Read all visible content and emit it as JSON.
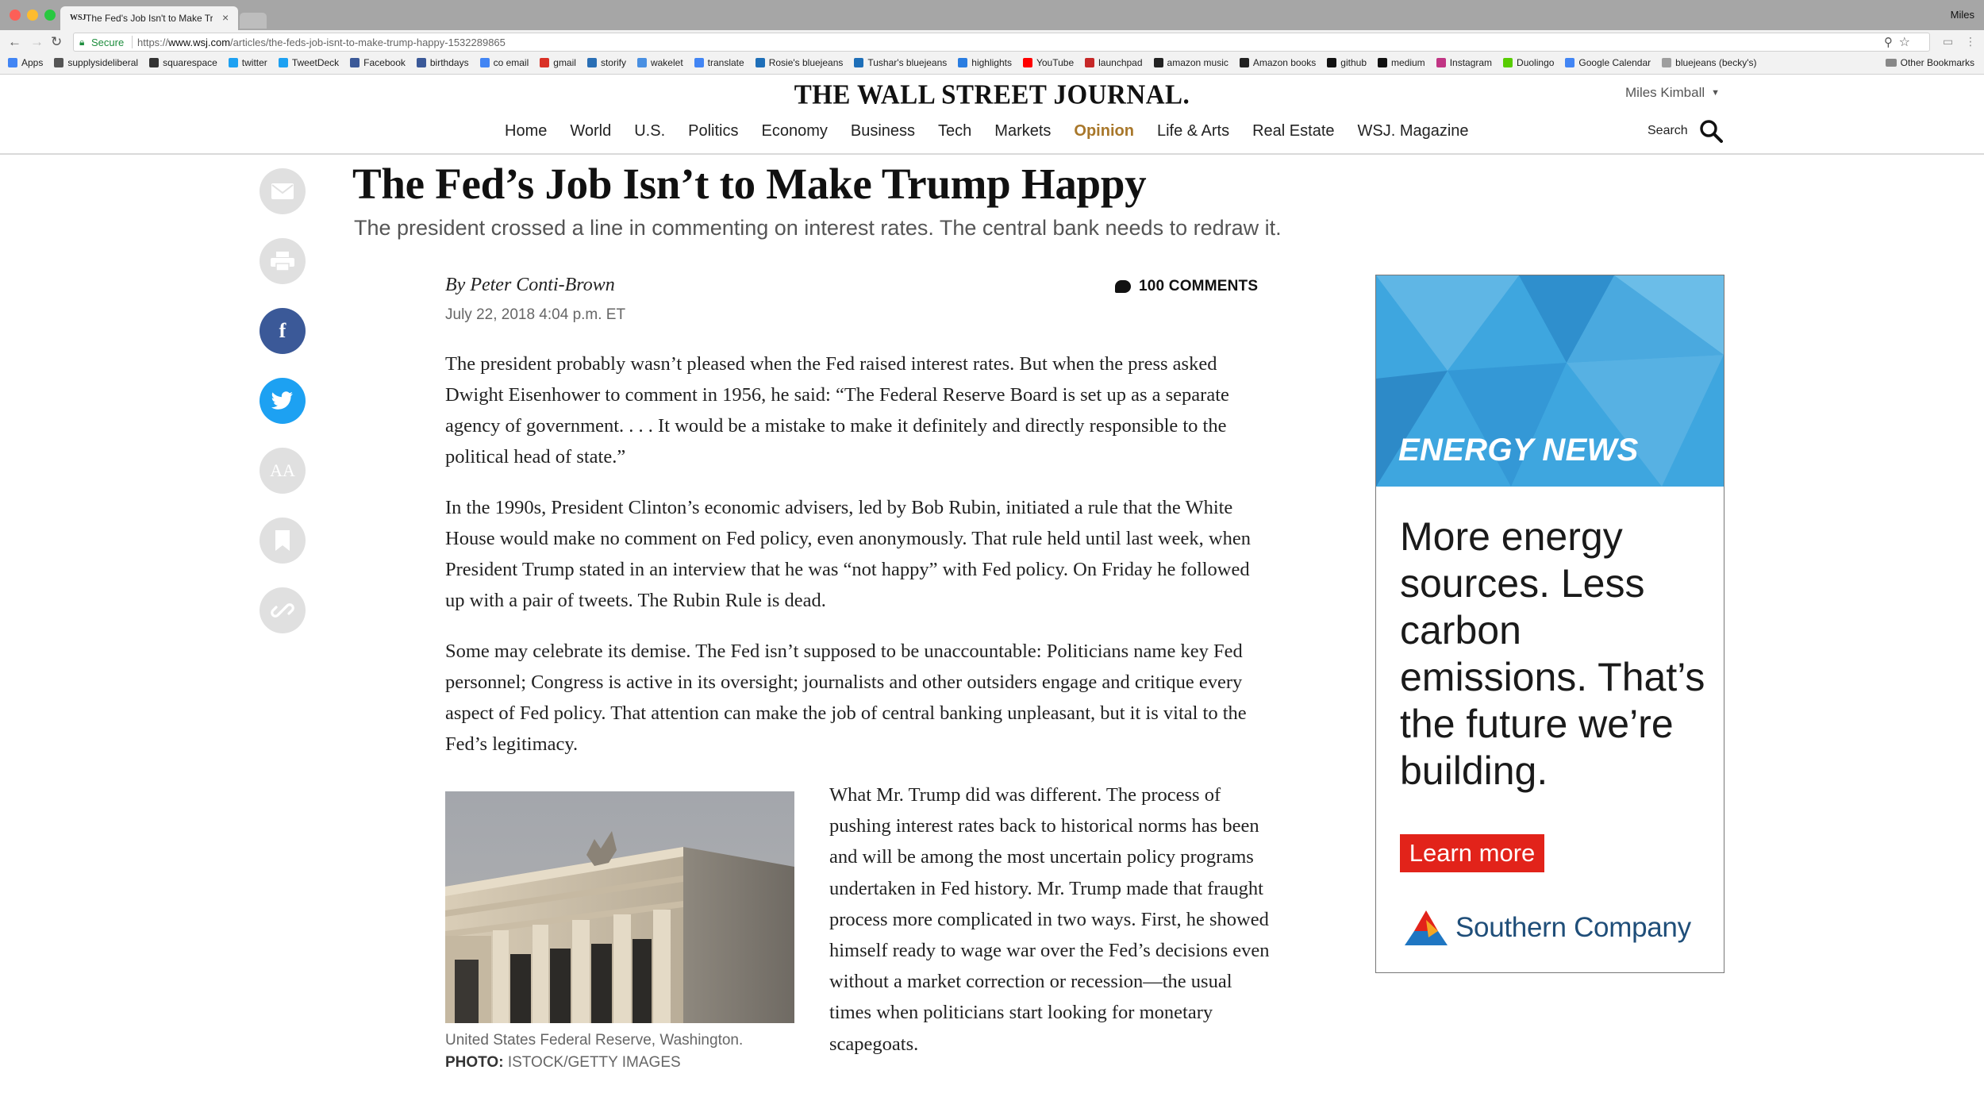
{
  "browser": {
    "tab_title": "The Fed's Job Isn't to Make Tr",
    "tab_favicon": "WSJ",
    "profile_name": "Miles",
    "secure_label": "Secure",
    "url_scheme": "https://",
    "url_host": "www.wsj.com",
    "url_path": "/articles/the-feds-job-isnt-to-make-trump-happy-1532289865",
    "bookmarks": [
      {
        "label": "Apps",
        "color": "#4285f4"
      },
      {
        "label": "supplysideliberal",
        "color": "#555555"
      },
      {
        "label": "squarespace",
        "color": "#333333"
      },
      {
        "label": "twitter",
        "color": "#1da1f2"
      },
      {
        "label": "TweetDeck",
        "color": "#1da1f2"
      },
      {
        "label": "Facebook",
        "color": "#3b5998"
      },
      {
        "label": "birthdays",
        "color": "#3b5998"
      },
      {
        "label": "co email",
        "color": "#4285f4"
      },
      {
        "label": "gmail",
        "color": "#d93025"
      },
      {
        "label": "storify",
        "color": "#2a6fb5"
      },
      {
        "label": "wakelet",
        "color": "#4a90e2"
      },
      {
        "label": "translate",
        "color": "#4285f4"
      },
      {
        "label": "Rosie's bluejeans",
        "color": "#1e6fb8"
      },
      {
        "label": "Tushar's bluejeans",
        "color": "#1e6fb8"
      },
      {
        "label": "highlights",
        "color": "#2a7de1"
      },
      {
        "label": "YouTube",
        "color": "#ff0000"
      },
      {
        "label": "launchpad",
        "color": "#c62828"
      },
      {
        "label": "amazon music",
        "color": "#222222"
      },
      {
        "label": "Amazon books",
        "color": "#222222"
      },
      {
        "label": "github",
        "color": "#111111"
      },
      {
        "label": "medium",
        "color": "#111111"
      },
      {
        "label": "Instagram",
        "color": "#c13584"
      },
      {
        "label": "Duolingo",
        "color": "#58cc02"
      },
      {
        "label": "Google Calendar",
        "color": "#4285f4"
      },
      {
        "label": "bluejeans (becky's)",
        "color": "#9e9e9e"
      }
    ],
    "other_bookmarks": "Other Bookmarks"
  },
  "site": {
    "logo": "THE WALL STREET JOURNAL.",
    "user_name": "Miles Kimball",
    "nav": [
      "Home",
      "World",
      "U.S.",
      "Politics",
      "Economy",
      "Business",
      "Tech",
      "Markets",
      "Opinion",
      "Life & Arts",
      "Real Estate",
      "WSJ. Magazine"
    ],
    "active_nav": "Opinion",
    "accent_color": "#a8772a",
    "search_label": "Search"
  },
  "share_rail": [
    "mail-icon",
    "print-icon",
    "facebook-icon",
    "twitter-icon",
    "text-size-icon",
    "bookmark-icon",
    "link-icon"
  ],
  "share_labels": {
    "text_size": "AA",
    "facebook": "f"
  },
  "article": {
    "headline": "The Fed’s Job Isn’t to Make Trump Happy",
    "dek": "The president crossed a line in commenting on interest rates. The central bank needs to redraw it.",
    "byline": "By Peter Conti-Brown",
    "date": "July 22, 2018 4:04 p.m. ET",
    "comments": "100 COMMENTS",
    "paragraphs": [
      "The president probably wasn’t pleased when the Fed raised interest rates. But when the press asked Dwight Eisenhower to comment in 1956, he said: “The Federal Reserve Board is set up as a separate agency of government. . . . It would be a mistake to make it definitely and directly responsible to the political head of state.”",
      "In the 1990s, President Clinton’s economic advisers, led by Bob Rubin, initiated a rule that the White House would make no comment on Fed policy, even anonymously. That rule held until last week, when President Trump stated in an interview that he was “not happy” with Fed policy. On Friday he followed up with a pair of tweets. The Rubin Rule is dead.",
      "Some may celebrate its demise. The Fed isn’t supposed to be unaccountable: Politicians name key Fed personnel; Congress is active in its oversight; journalists and other outsiders engage and critique every aspect of Fed policy. That attention can make the job of central banking unpleasant, but it is vital to the Fed’s legitimacy.",
      "What Mr. Trump did was different. The process of pushing interest rates back to historical norms has been and will be among the most uncertain policy programs undertaken in Fed history. Mr. Trump made that fraught process more complicated in two ways. First, he showed himself ready to wage war over the Fed’s decisions even without a market correction or recession—the usual times when politicians start looking for monetary scapegoats."
    ],
    "photo_caption": "United States Federal Reserve, Washington.",
    "photo_credit_label": "PHOTO:",
    "photo_credit": "ISTOCK/GETTY IMAGES"
  },
  "ad": {
    "kicker": "ENERGY NEWS",
    "copy": "More energy sources. Less carbon emissions. That’s the future we’re building.",
    "cta": "Learn more",
    "brand": "Southern Company",
    "top_color": "#3ea6df",
    "cta_color": "#e2231a"
  }
}
